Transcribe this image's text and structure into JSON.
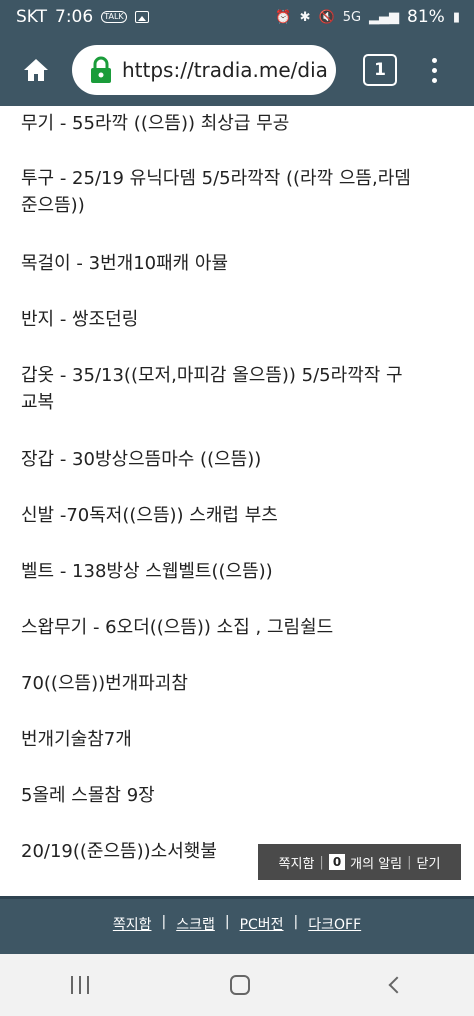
{
  "status_bar": {
    "carrier": "SKT",
    "time": "7:06",
    "talk_badge": "TALK",
    "network": "5G",
    "battery": "81%"
  },
  "browser": {
    "url": "https://tradia.me/dia",
    "tab_count": "1"
  },
  "content": {
    "lines": [
      "무기 - 55라깍 ((으뜸)) 최상급 무공",
      "투구 - 25/19 유닉다뎀 5/5라깍작 ((라깍 으뜸,라뎀",
      "준으뜸))",
      "목걸이 - 3번개10패캐 아뮬",
      "반지 - 쌍조던링",
      "갑옷 - 35/13((모저,마피감 올으뜸)) 5/5라깍작 구",
      "교복",
      "장갑 - 30방상으뜸마수 ((으뜸))",
      "신발 -70독저((으뜸)) 스캐럽 부츠",
      "벨트 - 138방상 스웹벨트((으뜸))",
      "스왑무기 - 6오더((으뜸)) 소집 , 그림쉴드",
      "70((으뜸))번개파괴참",
      "번개기술참7개",
      "5올레 스몰참 9장",
      "20/19((준으뜸))소서횃불"
    ]
  },
  "message_bar": {
    "label": "쪽지함",
    "count": "0",
    "alerts": "개의 알림",
    "close": "닫기"
  },
  "footer": {
    "links": [
      "쪽지함",
      "스크랩",
      "PC버전",
      "다크OFF"
    ]
  }
}
